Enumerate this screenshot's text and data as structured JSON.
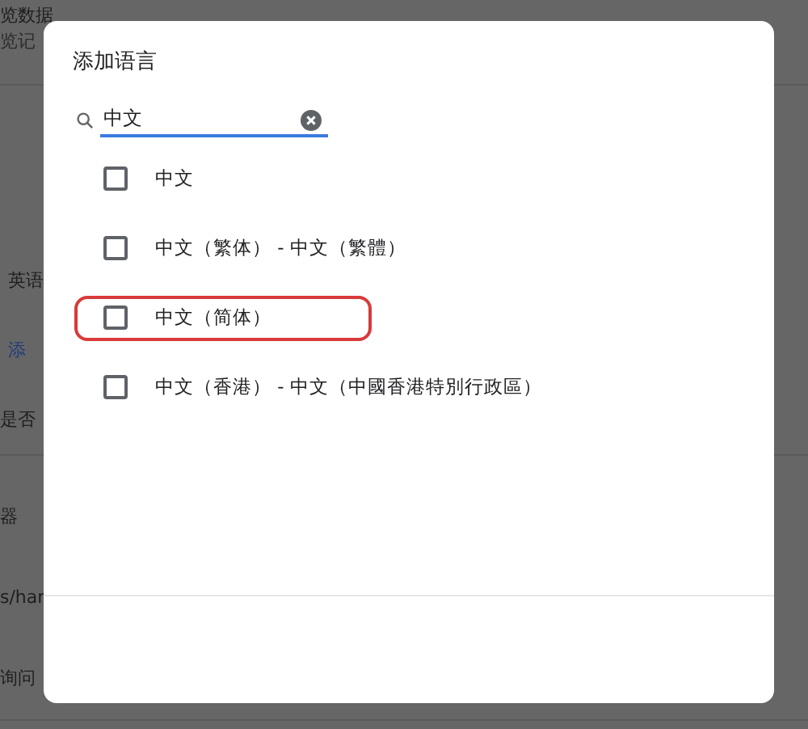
{
  "background_page": {
    "items": [
      {
        "text": "览数据",
        "kind": "title"
      },
      {
        "text": "览记",
        "kind": "sub"
      },
      {
        "text": "英语",
        "kind": "plain"
      },
      {
        "text": "添",
        "kind": "link"
      },
      {
        "text": "是否",
        "kind": "plain"
      },
      {
        "text": "器",
        "kind": "plain"
      },
      {
        "text": "s/har",
        "kind": "plain"
      },
      {
        "text": "询问",
        "kind": "plain"
      }
    ]
  },
  "dialog": {
    "title": "添加语言",
    "search": {
      "value": "中文"
    },
    "languages": [
      {
        "label": "中文",
        "checked": false,
        "highlighted": false
      },
      {
        "label": "中文（繁体） - 中文（繁體）",
        "checked": false,
        "highlighted": false
      },
      {
        "label": "中文（简体）",
        "checked": false,
        "highlighted": true
      },
      {
        "label": "中文（香港） - 中文（中國香港特別行政區）",
        "checked": false,
        "highlighted": false
      }
    ]
  }
}
